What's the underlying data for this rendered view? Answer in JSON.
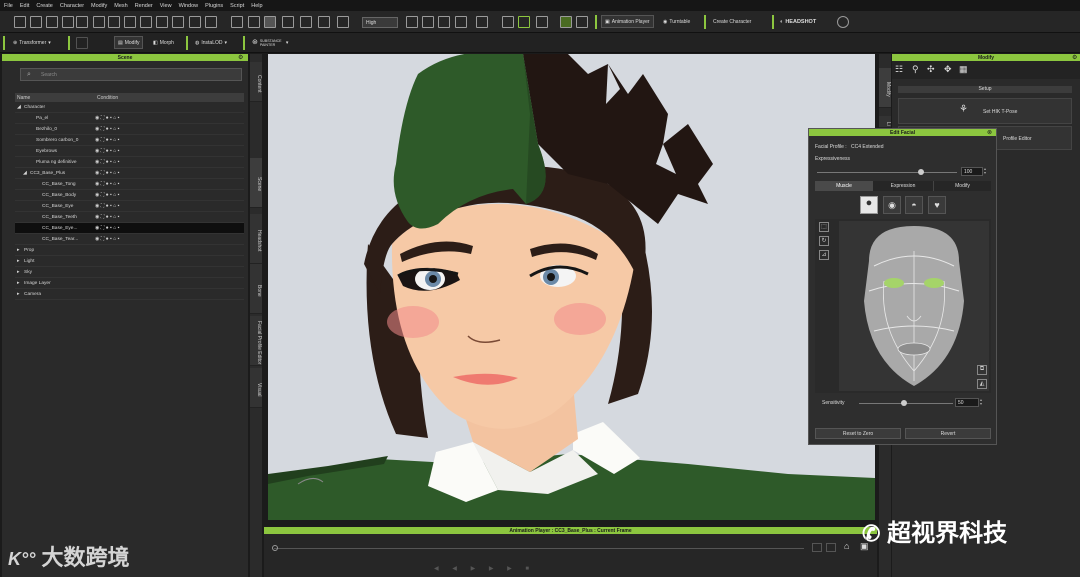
{
  "menu": [
    "File",
    "Edit",
    "Create",
    "Character",
    "Modify",
    "Mesh",
    "Render",
    "View",
    "Window",
    "Plugins",
    "Script",
    "Help"
  ],
  "toolbar1": {
    "quality": "High",
    "animation_player": "Animation Player",
    "turntable": "Turntable",
    "create_character": "Create Character",
    "headshot": "HEADSHOT"
  },
  "toolbar2": {
    "transformer": "Transformer",
    "modify": "Modify",
    "morph": "Morph",
    "insta_lod": "InstaLOD",
    "substance": "SUBSTANCE PAINTER"
  },
  "scene": {
    "title": "Scene",
    "search_placeholder": "Search",
    "col_name": "Name",
    "col_condition": "Condition",
    "rows": [
      {
        "label": "Character",
        "indent": 0
      },
      {
        "label": "Pa_el",
        "indent": 2
      },
      {
        "label": "Bezhilo_0",
        "indent": 2
      },
      {
        "label": "Sombrero carbon_0",
        "indent": 2
      },
      {
        "label": "Eyebrows",
        "indent": 2
      },
      {
        "label": "Pluma ng definitive",
        "indent": 2
      },
      {
        "label": "CC3_Base_Plus",
        "indent": 1
      },
      {
        "label": "CC_Base_Tong",
        "indent": 3
      },
      {
        "label": "CC_Base_Body",
        "indent": 3
      },
      {
        "label": "CC_Base_Eye",
        "indent": 3
      },
      {
        "label": "CC_Base_Teeth",
        "indent": 3
      },
      {
        "label": "CC_Base_Eye...",
        "indent": 3,
        "selected": true
      },
      {
        "label": "CC_Base_Tear...",
        "indent": 3
      },
      {
        "label": "Prop",
        "indent": 0
      },
      {
        "label": "Light",
        "indent": 0
      },
      {
        "label": "Sky",
        "indent": 0
      },
      {
        "label": "Image Layer",
        "indent": 0
      },
      {
        "label": "Camera",
        "indent": 0
      }
    ]
  },
  "side_tabs": [
    "Content",
    "Scene",
    "Headshot",
    "Bone",
    "Facial Profile Editor",
    "Visual"
  ],
  "right_tabs": [
    "Modify",
    "Li"
  ],
  "animation_player": {
    "title": "Animation Player : CC3_Base_Plus : Current Frame"
  },
  "modify_panel": {
    "title": "Modify",
    "setup": "Setup",
    "set_hik": "Set HIK T-Pose",
    "profile_editor": "Profile Editor"
  },
  "edit_facial": {
    "title": "Edit Facial",
    "facial_profile_label": "Facial Profile :",
    "facial_profile_value": "CC4 Extended",
    "expressiveness_label": "Expressiveness",
    "expressiveness_value": "100",
    "expressiveness_level": 1.0,
    "tabs": [
      "Muscle",
      "Expression",
      "Modify"
    ],
    "sensitivity_label": "Sensitivity",
    "sensitivity_value": "50",
    "reset_button": "Reset to Zero",
    "revert_button": "Revert"
  },
  "watermarks": {
    "left": "大数跨境",
    "right": "超视界科技"
  },
  "colors": {
    "accent": "#8cc63f",
    "hat": "#2e5a29",
    "hair": "#2c1d17",
    "skin": "#f6c9a6",
    "shirt": "#2f5a2a"
  }
}
